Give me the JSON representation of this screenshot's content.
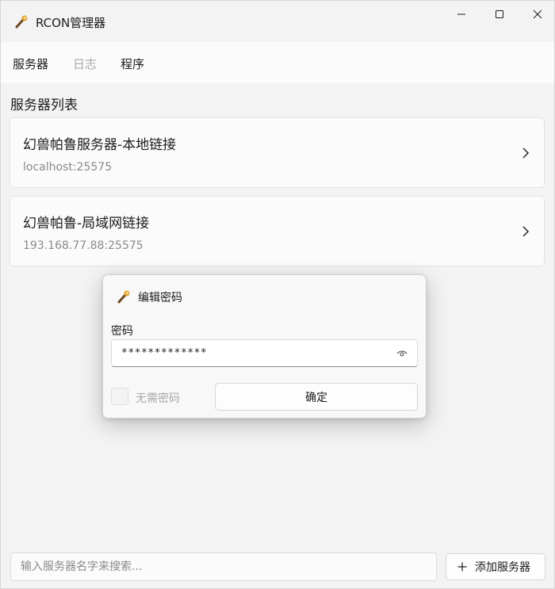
{
  "window": {
    "title": "RCON管理器",
    "icons": {
      "app": "torch-icon",
      "minimize": "minimize-icon",
      "maximize": "maximize-icon",
      "close": "close-icon"
    }
  },
  "menu": {
    "items": [
      {
        "label": "服务器",
        "enabled": true
      },
      {
        "label": "日志",
        "enabled": false
      },
      {
        "label": "程序",
        "enabled": true
      }
    ]
  },
  "server_list": {
    "title": "服务器列表",
    "servers": [
      {
        "name": "幻兽帕鲁服务器-本地链接",
        "address": "localhost:25575"
      },
      {
        "name": "幻兽帕鲁-局域网链接",
        "address": "193.168.77.88:25575"
      }
    ]
  },
  "dialog": {
    "title": "编辑密码",
    "password_label": "密码",
    "password_value": "*************",
    "no_password_label": "无需密码",
    "no_password_checked": false,
    "confirm_label": "确定"
  },
  "bottom": {
    "search_placeholder": "输入服务器名字来搜索...",
    "add_label": "添加服务器"
  },
  "colors": {
    "window_bg": "#f3f3f3",
    "card_bg": "#fbfbfb",
    "text": "#1b1b1b",
    "muted_text": "#8a8a8a",
    "disabled_text": "#a8a8a8"
  }
}
